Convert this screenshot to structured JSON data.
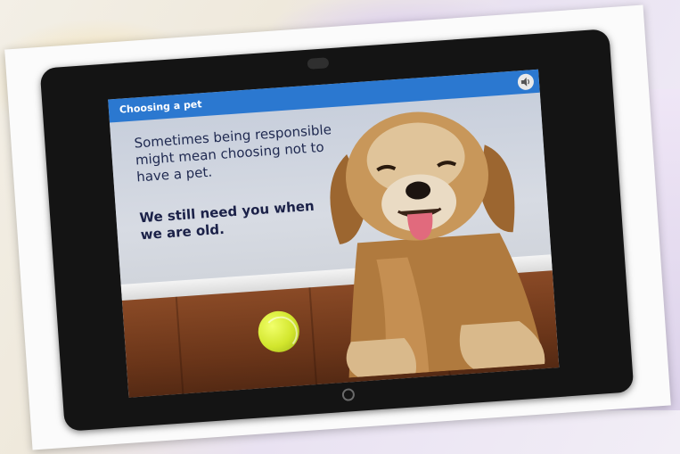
{
  "slide": {
    "title": "Choosing a pet",
    "body_text": "Sometimes being responsible might mean choosing not to have a pet.",
    "emphasis_text": "We still need you when we are old."
  },
  "icons": {
    "speaker": "speaker-icon",
    "camera": "camera-icon",
    "home_button": "home-button-icon"
  },
  "colors": {
    "title_bar": "#2b78d0",
    "text": "#1f2950",
    "ball": "#d2e62d"
  }
}
